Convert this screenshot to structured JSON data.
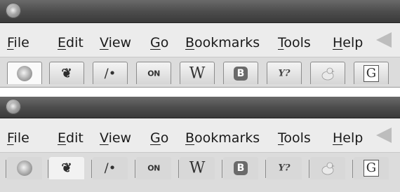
{
  "top": {
    "menu": [
      {
        "pre": "",
        "u": "F",
        "post": "ile"
      },
      {
        "pre": "",
        "u": "E",
        "post": "dit"
      },
      {
        "pre": "",
        "u": "V",
        "post": "iew"
      },
      {
        "pre": "",
        "u": "G",
        "post": "o"
      },
      {
        "pre": "",
        "u": "B",
        "post": "ookmarks"
      },
      {
        "pre": "",
        "u": "T",
        "post": "ools"
      },
      {
        "pre": "",
        "u": "H",
        "post": "elp"
      }
    ],
    "tabs": [
      {
        "icon": "firefox-icon"
      },
      {
        "icon": "lion-icon",
        "glyph": "🦁"
      },
      {
        "icon": "pen-icon",
        "glyph": "/•"
      },
      {
        "icon": "cnn-icon",
        "glyph": "CN"
      },
      {
        "icon": "wikipedia-icon",
        "glyph": "W"
      },
      {
        "icon": "blogger-icon",
        "glyph": "B"
      },
      {
        "icon": "yahoo-icon",
        "glyph": "Y?"
      },
      {
        "icon": "duck-icon"
      },
      {
        "icon": "google-icon",
        "glyph": "G"
      }
    ]
  },
  "bottom": {
    "menu": [
      {
        "pre": "",
        "u": "F",
        "post": "ile"
      },
      {
        "pre": "",
        "u": "E",
        "post": "dit"
      },
      {
        "pre": "",
        "u": "V",
        "post": "iew"
      },
      {
        "pre": "",
        "u": "G",
        "post": "o"
      },
      {
        "pre": "",
        "u": "B",
        "post": "ookmarks"
      },
      {
        "pre": "",
        "u": "T",
        "post": "ools"
      },
      {
        "pre": "",
        "u": "H",
        "post": "elp"
      }
    ]
  },
  "colors": {
    "titlebar": "#4d4d4d",
    "menubar": "#ececec",
    "tabbar": "#dcdcdc"
  }
}
